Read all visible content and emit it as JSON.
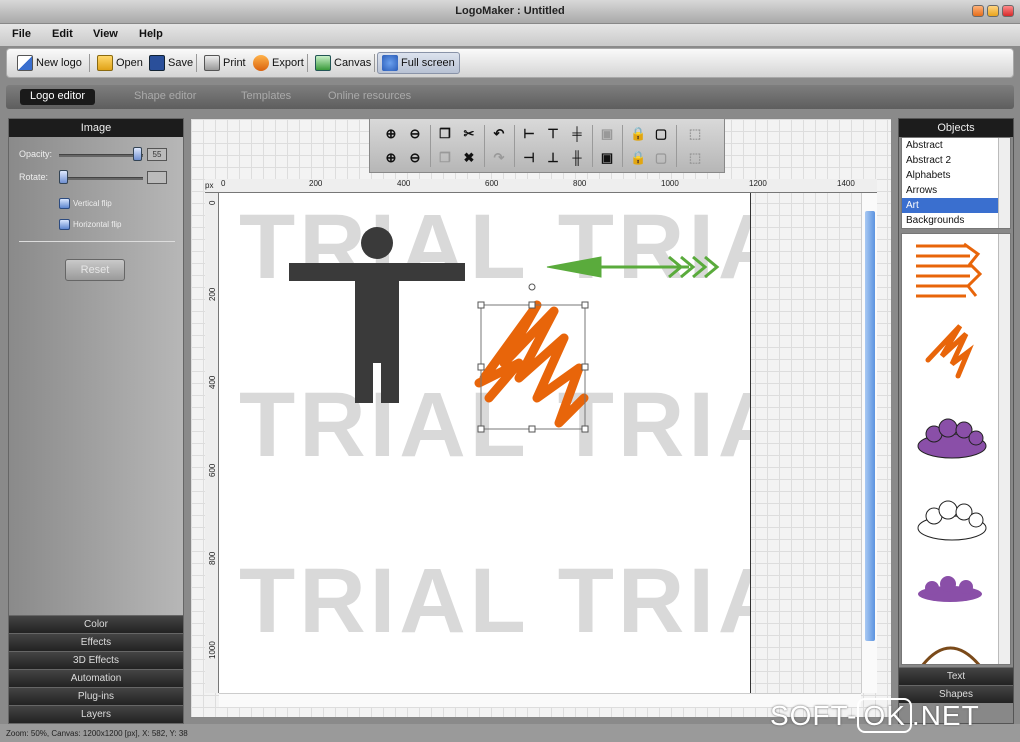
{
  "window": {
    "title": "LogoMaker : Untitled"
  },
  "menu": [
    "File",
    "Edit",
    "View",
    "Help"
  ],
  "toolbar": {
    "new_logo": "New logo",
    "open": "Open",
    "save": "Save",
    "print": "Print",
    "export": "Export",
    "canvas": "Canvas",
    "full_screen": "Full screen"
  },
  "mode_tabs": [
    "Logo editor",
    "Shape editor",
    "Templates",
    "Online resources"
  ],
  "left_panel": {
    "header": "Image",
    "opacity_label": "Opacity:",
    "opacity_value": "55",
    "rotate_label": "Rotate:",
    "rotate_value": "",
    "vertical_flip": "Vertical flip",
    "horizontal_flip": "Horizontal flip",
    "reset": "Reset",
    "sections": [
      "Color",
      "Effects",
      "3D Effects",
      "Automation",
      "Plug-ins",
      "Layers"
    ]
  },
  "canvas": {
    "ruler_unit": "px",
    "ruler_h": [
      "0",
      "200",
      "400",
      "600",
      "800",
      "1000",
      "1200",
      "1400"
    ],
    "ruler_v": [
      "0",
      "200",
      "400",
      "600",
      "800",
      "1000"
    ],
    "watermark": "TRIAL TRIAL"
  },
  "right_panel": {
    "header": "Objects",
    "categories": [
      "Abstract",
      "Abstract 2",
      "Alphabets",
      "Arrows",
      "Art",
      "Backgrounds"
    ],
    "selected": "Art",
    "sections": [
      "Text",
      "Shapes"
    ]
  },
  "status": {
    "text": "Zoom: 50%, Canvas: 1200x1200 [px], X: 582, Y: 38"
  },
  "watermark_site": {
    "left": "SOFT-",
    "box": "OK",
    "right": ".NET"
  },
  "colors": {
    "accent_orange": "#e8650a",
    "arrow_green": "#5aab3c",
    "figure": "#3a3a3a",
    "purple": "#8a4fa8"
  }
}
